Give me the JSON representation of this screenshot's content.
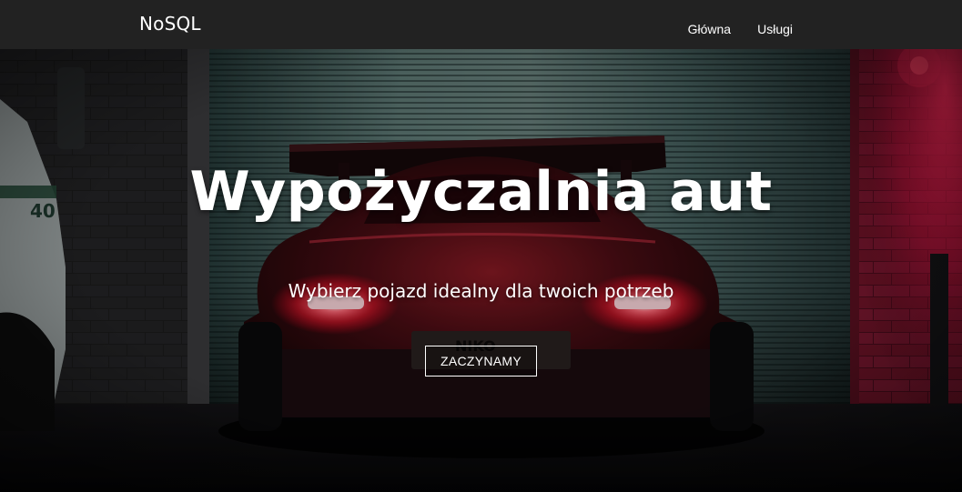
{
  "navbar": {
    "brand": "NoSQL",
    "links": [
      {
        "label": "Główna"
      },
      {
        "label": "Usługi"
      }
    ]
  },
  "hero": {
    "title": "Wypożyczalnia aut",
    "subtitle": "Wybierz pojazd idealny dla twoich potrzeb",
    "cta_label": "ZACZYNAMY",
    "background": "night-car-garage-photo"
  },
  "colors": {
    "navbar_bg": "#222222",
    "text": "#ffffff",
    "tail_light": "#ff2a3c",
    "neon_pink": "#e0104a"
  }
}
